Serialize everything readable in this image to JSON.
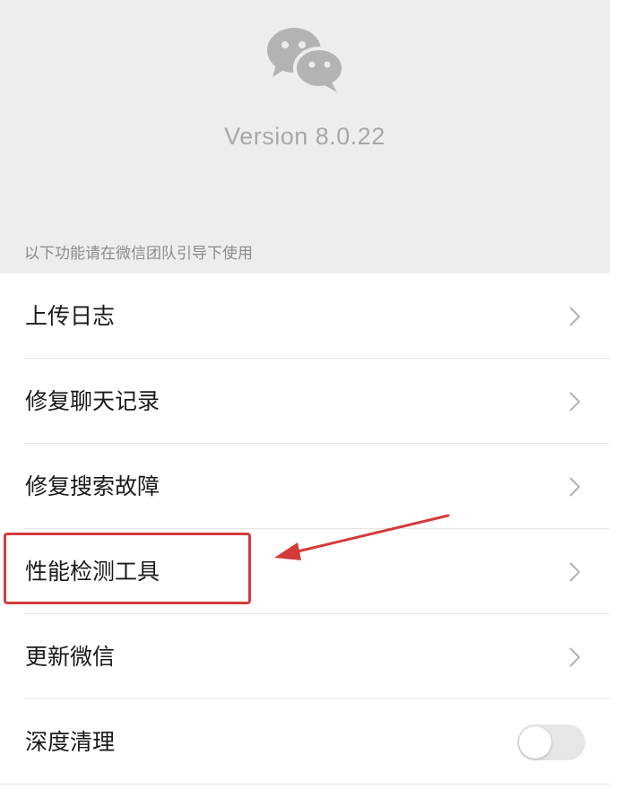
{
  "header": {
    "logo_icon": "wechat-logo-icon",
    "version_text": "Version 8.0.22"
  },
  "section": {
    "note": "以下功能请在微信团队引导下使用"
  },
  "menu": {
    "items": [
      {
        "label": "上传日志",
        "control": "chevron-right-icon"
      },
      {
        "label": "修复聊天记录",
        "control": "chevron-right-icon"
      },
      {
        "label": "修复搜索故障",
        "control": "chevron-right-icon"
      },
      {
        "label": "性能检测工具",
        "control": "chevron-right-icon"
      },
      {
        "label": "更新微信",
        "control": "chevron-right-icon"
      },
      {
        "label": "深度清理",
        "control": "toggle-switch",
        "toggle_on": false
      }
    ]
  },
  "annotation": {
    "highlight_color": "#d43a3a",
    "highlighted_item": "性能检测工具"
  },
  "colors": {
    "panel_background": "#ededed",
    "logo_gray": "#b3b3b3",
    "text_primary": "#1a1a1a",
    "text_secondary": "#8b8b8b",
    "chevron": "#b2b2b2"
  }
}
